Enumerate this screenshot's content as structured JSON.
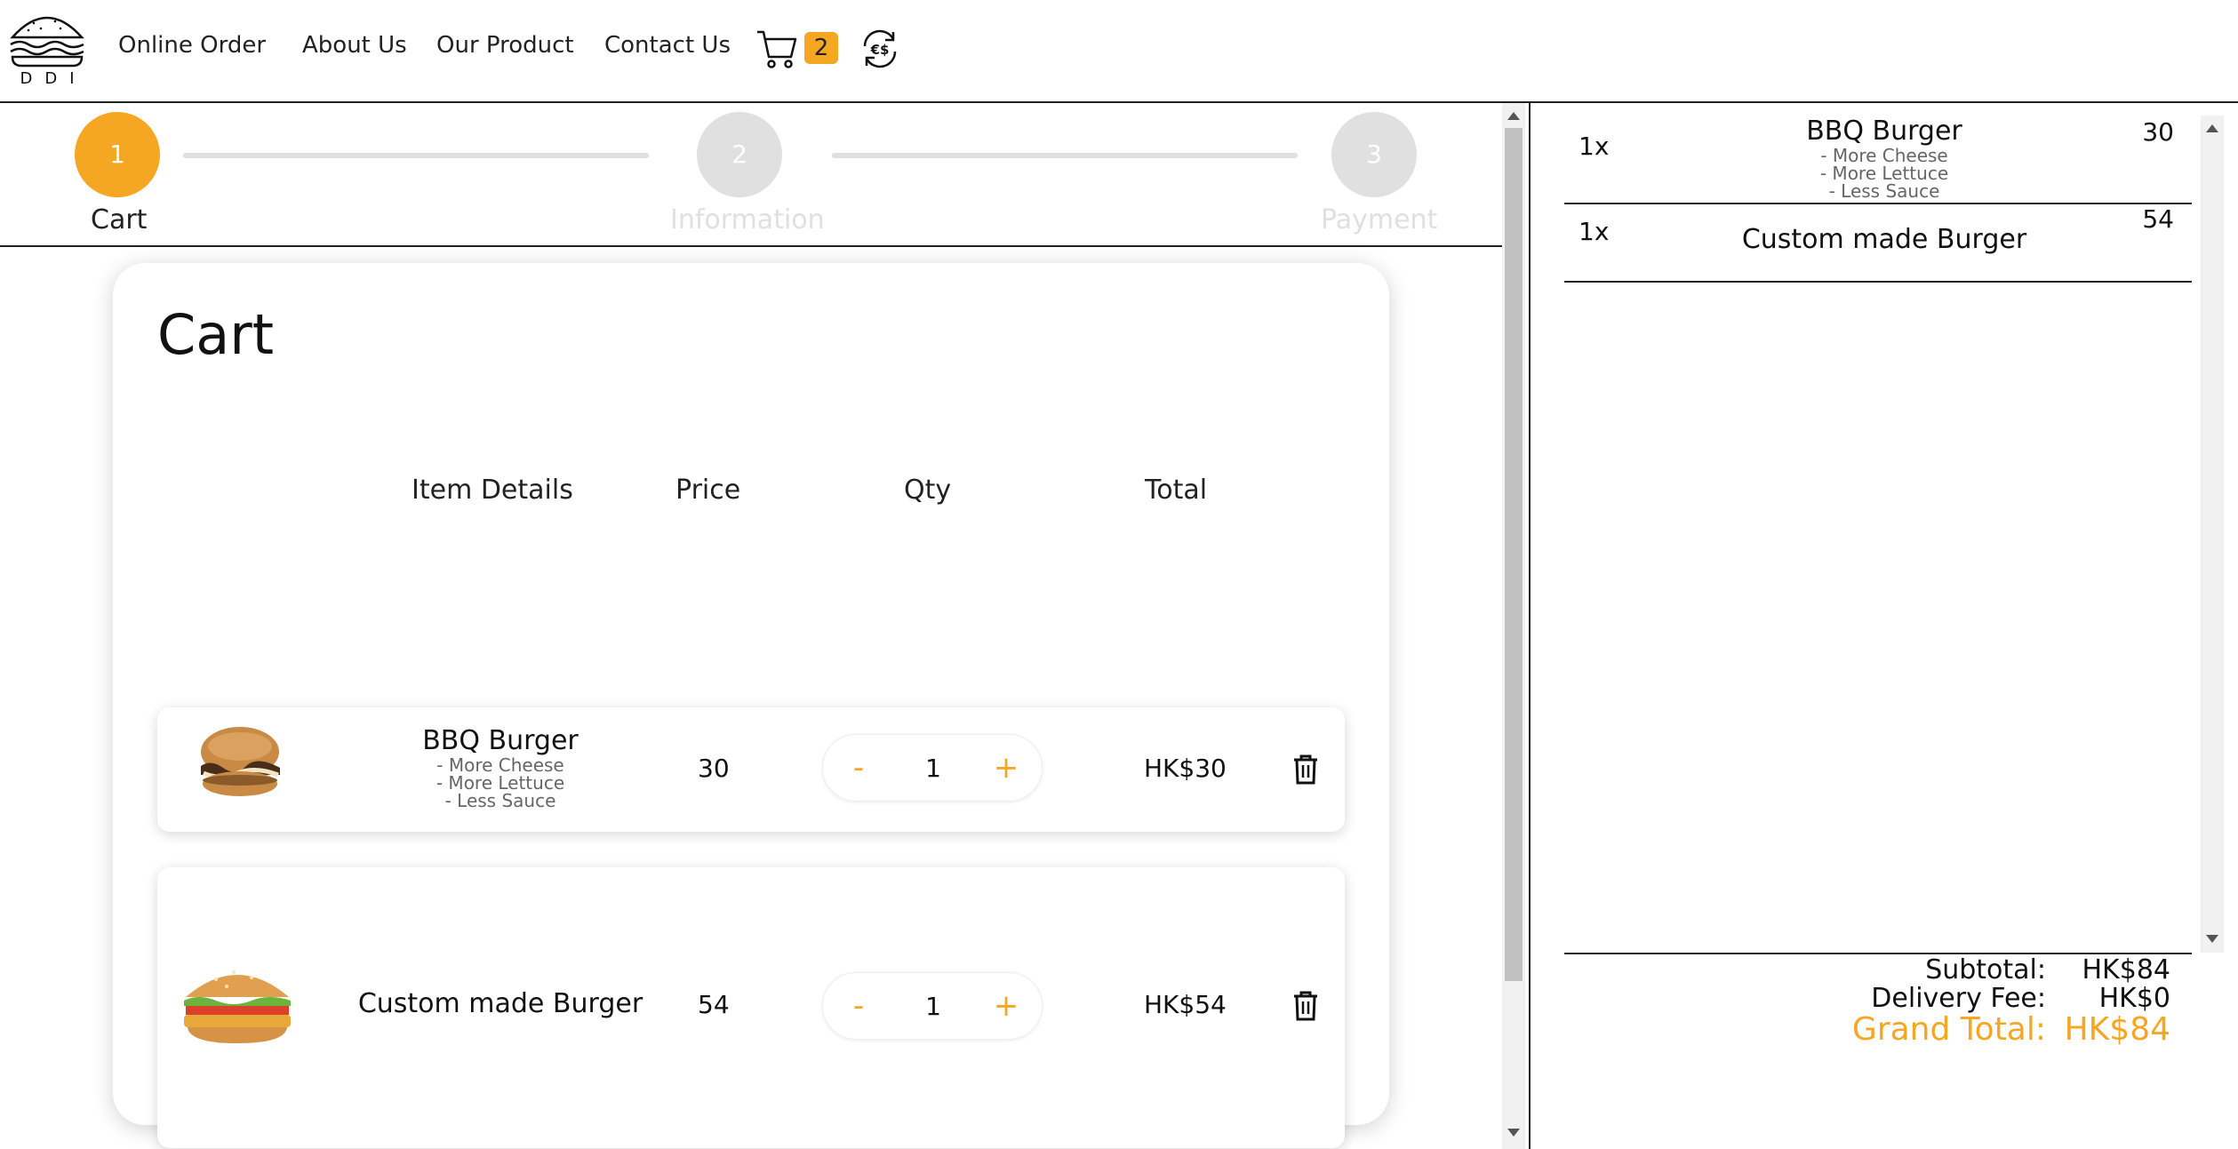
{
  "nav": {
    "logo_text": "DDI",
    "links": [
      "Online Order",
      "About Us",
      "Our Product",
      "Contact Us"
    ],
    "cart_count": "2",
    "accent": "#f5a623"
  },
  "stepper": {
    "steps": [
      {
        "number": "1",
        "label": "Cart",
        "active": true
      },
      {
        "number": "2",
        "label": "Information",
        "active": false
      },
      {
        "number": "3",
        "label": "Payment",
        "active": false
      }
    ]
  },
  "cart": {
    "title": "Cart",
    "columns": {
      "details": "Item Details",
      "price": "Price",
      "qty": "Qty",
      "total": "Total"
    },
    "items": [
      {
        "name": "BBQ Burger",
        "options": [
          "- More Cheese",
          "- More Lettuce",
          "- Less Sauce"
        ],
        "price": "30",
        "qty": "1",
        "total": "HK$30",
        "minus": "-",
        "plus": "+"
      },
      {
        "name": "Custom made Burger",
        "options": [],
        "price": "54",
        "qty": "1",
        "total": "HK$54",
        "minus": "-",
        "plus": "+"
      }
    ]
  },
  "summary": {
    "items": [
      {
        "qty": "1x",
        "name": "BBQ Burger",
        "options": [
          "- More Cheese",
          "- More Lettuce",
          "- Less Sauce"
        ],
        "price": "30"
      },
      {
        "qty": "1x",
        "name": "Custom made Burger",
        "options": [],
        "price": "54"
      }
    ],
    "subtotal_label": "Subtotal:",
    "subtotal": "HK$84",
    "delivery_label": "Delivery Fee:",
    "delivery": "HK$0",
    "grand_label": "Grand Total:",
    "grand": "HK$84"
  }
}
